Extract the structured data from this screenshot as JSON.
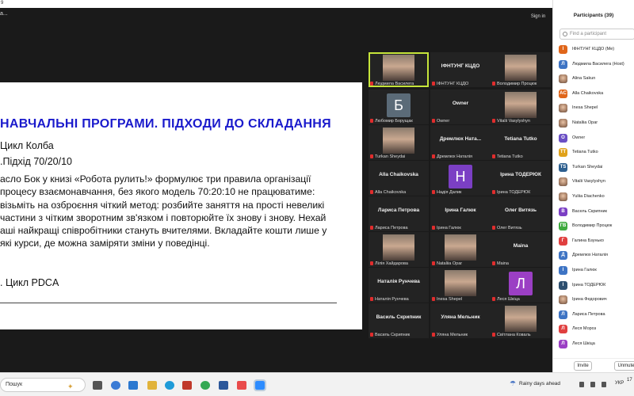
{
  "window": {
    "title": "9",
    "left_label": "a...",
    "sign_in": "Sign in"
  },
  "slide": {
    "title": "НАВЧАЛЬНІ ПРОГРАМИ. ПІДХОДИ ДО СКЛАДАННЯ",
    "sub1": "Цикл Колба",
    "sub2": ".Підхід 70/20/10",
    "body_lines": [
      "асло Бок у  книзі «Робота рулить!» формулює три правила організації",
      "процесу взаємонавчання, без якого модель 70:20:10 не працюватиме:",
      "візьміть на озброєння чіткий метод: розбийте заняття на прості невеликі",
      "частини з чітким зворотним зв'язком і повторюйте їх знову і знову. Нехай",
      "аші найкращі співробітники стануть вчителями. Вкладайте кошти лише у",
      "які курси, де можна заміряти зміни у поведінці."
    ],
    "sub3": ". Цикл PDCA"
  },
  "gallery": {
    "tiles": [
      {
        "big": "",
        "label": "Людмила Василега",
        "kind": "photo"
      },
      {
        "big": "ІФНТУНГ КЦДО",
        "label": "ІФНТУНГ КЦДО",
        "kind": "name"
      },
      {
        "big": "",
        "label": "Володимир Процюк",
        "kind": "photo"
      },
      {
        "big": "Б",
        "label": "Любомир Борущак",
        "kind": "avatar",
        "color": "#5b6b78"
      },
      {
        "big": "Owner",
        "label": "Owner",
        "kind": "name"
      },
      {
        "big": "",
        "label": "Vitalii Vasylyshyn",
        "kind": "photo"
      },
      {
        "big": "",
        "label": "Turkan Sheydai",
        "kind": "photo"
      },
      {
        "big": "Дремлюх  Ната...",
        "label": "Дремлюх Наталія",
        "kind": "name"
      },
      {
        "big": "Tetiana Tutko",
        "label": "Tetiana Tutko",
        "kind": "name"
      },
      {
        "big": "Alla Chaikovska",
        "label": "Alla Chaikovska",
        "kind": "name"
      },
      {
        "big": "Н",
        "label": "Надія Далик",
        "kind": "avatar",
        "color": "#7b3fc4"
      },
      {
        "big": "Ірина ТОДЕРЮК",
        "label": "Ірина ТОДЕРЮК",
        "kind": "name"
      },
      {
        "big": "Лариса Петрова",
        "label": "Лариса Петрова",
        "kind": "name"
      },
      {
        "big": "Ірина Галюк",
        "label": "Ірина Галюк",
        "kind": "name"
      },
      {
        "big": "Олег Витязь",
        "label": "Олег Витязь",
        "kind": "name"
      },
      {
        "big": "",
        "label": "Лілія Хайдарова",
        "kind": "photo"
      },
      {
        "big": "",
        "label": "Nataliia Opar",
        "kind": "photo"
      },
      {
        "big": "Maina",
        "label": "Maina",
        "kind": "name"
      },
      {
        "big": "Наталія Рунчева",
        "label": "Наталія Рунчева",
        "kind": "name"
      },
      {
        "big": "",
        "label": "Inesa Shepel",
        "kind": "photo"
      },
      {
        "big": "Л",
        "label": "Леся Шкіца",
        "kind": "avatar",
        "color": "#9b3fc4"
      },
      {
        "big": "Василь Скрипник",
        "label": "Василь Скрипник",
        "kind": "name"
      },
      {
        "big": "Уляна Мельник",
        "label": "Уляна Мельник",
        "kind": "name"
      },
      {
        "big": "",
        "label": "Світлана Коваль",
        "kind": "photo"
      }
    ]
  },
  "participants": {
    "title": "Participants (39)",
    "search_placeholder": "Find a participant",
    "items": [
      {
        "initial": "І",
        "name": "ІФНТУНГ КЦДО (Me)",
        "color": "#e0661a"
      },
      {
        "initial": "Л",
        "name": "Людмила Василега (Host)",
        "color": "#3e74c4"
      },
      {
        "initial": "",
        "name": "Alina Sakun",
        "color": "photo"
      },
      {
        "initial": "AC",
        "name": "Alla Chaikovska",
        "color": "#e0661a"
      },
      {
        "initial": "",
        "name": "Inesa Shepel",
        "color": "photo"
      },
      {
        "initial": "",
        "name": "Nataliia Opar",
        "color": "photo"
      },
      {
        "initial": "O",
        "name": "Owner",
        "color": "#6a4fc4"
      },
      {
        "initial": "TT",
        "name": "Tetiana Tutko",
        "color": "#e0a21a"
      },
      {
        "initial": "TS",
        "name": "Turkan Sheydai",
        "color": "#2d5f8f"
      },
      {
        "initial": "",
        "name": "Vitalii Vasylyshyn",
        "color": "photo"
      },
      {
        "initial": "",
        "name": "Yuliia Diachenko",
        "color": "photo"
      },
      {
        "initial": "В",
        "name": "Васель Скрипник",
        "color": "#7b3fc4"
      },
      {
        "initial": "ГВ",
        "name": "Володимир Процюк",
        "color": "#3faa3f"
      },
      {
        "initial": "Г",
        "name": "Галина Бзунько",
        "color": "#e03f3f"
      },
      {
        "initial": "Д",
        "name": "Дремлюх Наталія",
        "color": "#3e74c4"
      },
      {
        "initial": "І",
        "name": "Ірина Галюк",
        "color": "#3e74c4"
      },
      {
        "initial": "І",
        "name": "Ірина ТОДЕРЮК",
        "color": "#2d4f6f"
      },
      {
        "initial": "",
        "name": "Ірина Федорович",
        "color": "photo"
      },
      {
        "initial": "Л",
        "name": "Лариса Петрова",
        "color": "#3e74c4"
      },
      {
        "initial": "Л",
        "name": "Леся Мороз",
        "color": "#e03f3f"
      },
      {
        "initial": "Л",
        "name": "Леся Шкіца",
        "color": "#9b3fc4"
      }
    ],
    "invite_label": "Invite",
    "unmute_label": "Unmute"
  },
  "taskbar": {
    "search_text": "Пошук",
    "weather": "Rainy days ahead",
    "lang": "УКР",
    "clock": "17"
  }
}
